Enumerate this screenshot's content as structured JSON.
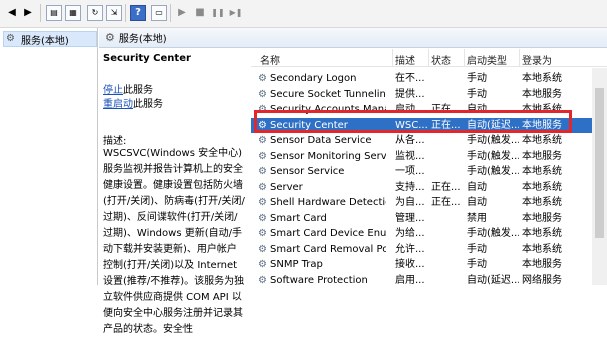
{
  "toolbar": {
    "icons": [
      "back-arrow",
      "forward-arrow",
      "console-tree",
      "properties",
      "refresh",
      "export",
      "help",
      "monitor",
      "start",
      "stop",
      "pause",
      "restart"
    ],
    "help_label": "?",
    "start_glyph": "▶",
    "stop_glyph": "■",
    "pause_glyph": "❚❚",
    "restart_glyph": "▶❚"
  },
  "tree": {
    "item_label": "服务(本地)"
  },
  "main": {
    "header_title": "服务(本地)"
  },
  "description": {
    "title": "Security Center",
    "stop_link": "停止",
    "stop_suffix": "此服务",
    "restart_link": "重启动",
    "restart_suffix": "此服务",
    "label": "描述:",
    "text": "WSCSVC(Windows 安全中心)服务监视并报告计算机上的安全健康设置。健康设置包括防火墙(打开/关闭)、防病毒(打开/关闭/过期)、反间谍软件(打开/关闭/过期)、Windows 更新(自动/手动下载并安装更新)、用户帐户控制(打开/关闭)以及 Internet 设置(推荐/不推荐)。该服务为独立软件供应商提供 COM API 以便向安全中心服务注册并记录其产品的状态。安全性"
  },
  "list": {
    "columns": {
      "name": "名称",
      "desc": "描述",
      "state": "状态",
      "startup": "启动类型",
      "logon": "登录为"
    },
    "rows": [
      {
        "name": "Secondary Logon",
        "desc": "在不...",
        "state": "",
        "startup": "手动",
        "logon": "本地系统"
      },
      {
        "name": "Secure Socket Tunneling ...",
        "desc": "提供...",
        "state": "",
        "startup": "手动",
        "logon": "本地服务"
      },
      {
        "name": "Security Accounts Manag...",
        "desc": "启动...",
        "state": "正在...",
        "startup": "自动",
        "logon": "本地系统"
      },
      {
        "name": "Security Center",
        "desc": "WSC...",
        "state": "正在...",
        "startup": "自动(延迟...",
        "logon": "本地服务"
      },
      {
        "name": "Sensor Data Service",
        "desc": "从各...",
        "state": "",
        "startup": "手动(触发...",
        "logon": "本地系统"
      },
      {
        "name": "Sensor Monitoring Service",
        "desc": "监视...",
        "state": "",
        "startup": "手动(触发...",
        "logon": "本地服务"
      },
      {
        "name": "Sensor Service",
        "desc": "一项...",
        "state": "",
        "startup": "手动(触发...",
        "logon": "本地系统"
      },
      {
        "name": "Server",
        "desc": "支持...",
        "state": "正在...",
        "startup": "自动",
        "logon": "本地系统"
      },
      {
        "name": "Shell Hardware Detection",
        "desc": "为自...",
        "state": "正在...",
        "startup": "自动",
        "logon": "本地系统"
      },
      {
        "name": "Smart Card",
        "desc": "管理...",
        "state": "",
        "startup": "禁用",
        "logon": "本地服务"
      },
      {
        "name": "Smart Card Device Enum...",
        "desc": "为给...",
        "state": "",
        "startup": "手动(触发...",
        "logon": "本地系统"
      },
      {
        "name": "Smart Card Removal Poli...",
        "desc": "允许...",
        "state": "",
        "startup": "手动",
        "logon": "本地系统"
      },
      {
        "name": "SNMP Trap",
        "desc": "接收...",
        "state": "",
        "startup": "手动",
        "logon": "本地服务"
      },
      {
        "name": "Software Protection",
        "desc": "启用...",
        "state": "",
        "startup": "自动(延迟...",
        "logon": "网络服务"
      }
    ],
    "selected_index": 3
  },
  "colors": {
    "selection": "#2e70c5",
    "highlight_border": "#e3262c",
    "link": "#1a4fb8"
  }
}
